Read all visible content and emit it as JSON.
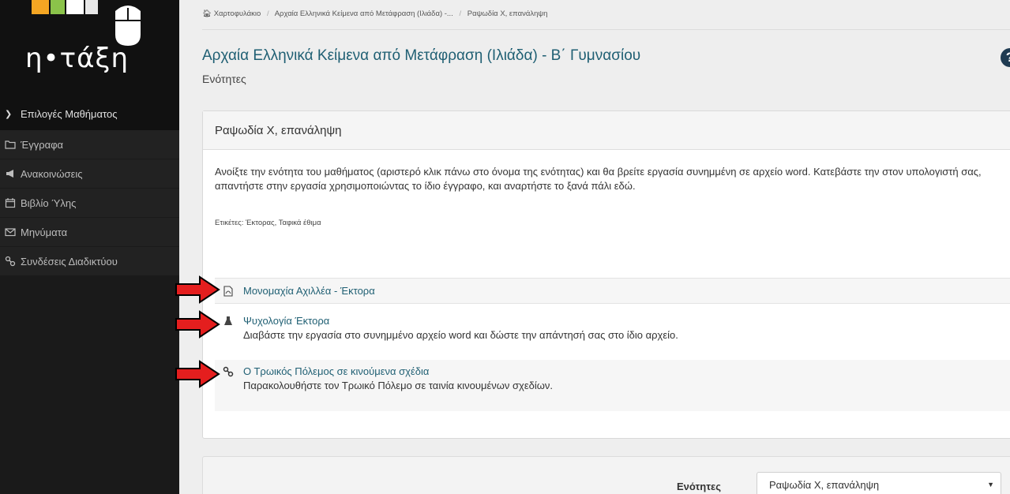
{
  "logo": {
    "text": "η•τάξη"
  },
  "sidebar": {
    "header": "Επιλογές Μαθήματος",
    "items": [
      {
        "label": "Έγγραφα",
        "icon": "folder-icon"
      },
      {
        "label": "Ανακοινώσεις",
        "icon": "megaphone-icon"
      },
      {
        "label": "Βιβλίο Ύλης",
        "icon": "calendar-icon"
      },
      {
        "label": "Μηνύματα",
        "icon": "envelope-icon"
      },
      {
        "label": "Συνδέσεις Διαδικτύου",
        "icon": "link-icon"
      }
    ]
  },
  "breadcrumb": {
    "home": "Χαρτοφυλάκιο",
    "course": "Αρχαία Ελληνικά Κείμενα από Μετάφραση (Ιλιάδα) -...",
    "current": "Ραψωδία Χ, επανάληψη"
  },
  "page": {
    "title": "Αρχαία Ελληνικά Κείμενα από Μετάφραση (Ιλιάδα) - Β΄ Γυμνασίου",
    "subtitle": "Ενότητες",
    "help": "?"
  },
  "section": {
    "title": "Ραψωδία Χ, επανάληψη",
    "description": "Ανοίξτε την ενότητα του μαθήματος (αριστερό κλικ πάνω στο όνομα της ενότητας) και θα βρείτε εργασία συνημμένη σε αρχείο word. Κατεβάστε την στον υπολογιστή σας, απαντήστε στην εργασία χρησιμοποιώντας το ίδιο έγγραφο, και αναρτήστε το ξανά πάλι εδώ.",
    "tags": "Ετικέτες: Έκτορας, Ταφικά έθιμα",
    "resources": [
      {
        "title": "Μονομαχία Αχιλλέα - Έκτορα",
        "description": "",
        "icon": "pdf-icon"
      },
      {
        "title": "Ψυχολογία Έκτορα",
        "description": "Διαβάστε την εργασία στο συνημμένο αρχείο word και δώστε την απάντησή σας στο ίδιο αρχείο.",
        "icon": "flask-icon"
      },
      {
        "title": "Ο Τρωικός Πόλεμος σε κινούμενα σχέδια",
        "description": "Παρακολουθήστε τον Τρωικό Πόλεμο σε ταινία κινουμένων σχεδίων.",
        "icon": "link-icon"
      }
    ]
  },
  "footer": {
    "label": "Ενότητες",
    "selected": "Ραψωδία Χ, επανάληψη"
  },
  "colors": {
    "accent": "#1f5f73",
    "sidebar": "#1a1a1a",
    "arrow": "#e41e1e"
  }
}
